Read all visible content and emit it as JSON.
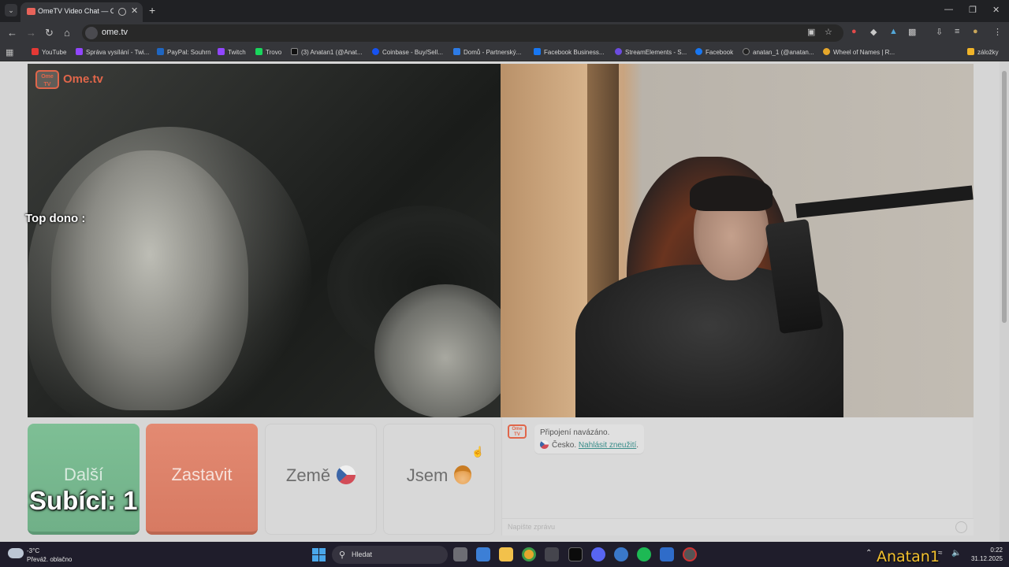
{
  "browser": {
    "tab_title": "OmeTV Video Chat — Omegle",
    "url": "ome.tv",
    "bookmarks": [
      {
        "label": "YouTube",
        "color": "#e53935"
      },
      {
        "label": "Správa vysílání - Twi...",
        "color": "#9146ff"
      },
      {
        "label": "PayPal: Souhrn",
        "color": "#1f66c1"
      },
      {
        "label": "Twitch",
        "color": "#9146ff"
      },
      {
        "label": "Trovo",
        "color": "#19d65c"
      },
      {
        "label": "(3) Anatan1 (@Anat...",
        "color": "#111111"
      },
      {
        "label": "Coinbase - Buy/Sell...",
        "color": "#1652f0"
      },
      {
        "label": "Domů - Partnerský...",
        "color": "#2d7be5"
      },
      {
        "label": "Facebook Business...",
        "color": "#1877f2"
      },
      {
        "label": "StreamElements - S...",
        "color": "#6c4ce0"
      },
      {
        "label": "Facebook",
        "color": "#1877f2"
      },
      {
        "label": "anatan_1 (@anatan...",
        "color": "#222222"
      },
      {
        "label": "Wheel of Names | R...",
        "color": "#e6a72b"
      },
      {
        "label": "záložky",
        "color": "#f0b429"
      }
    ]
  },
  "site": {
    "logo_box": "Ome TV",
    "logo_text": "Ome.tv"
  },
  "overlay": {
    "top_dono": "Top dono :",
    "subs": "Subíci: 1",
    "watermark": "Anatan1"
  },
  "buttons": {
    "next": "Další",
    "stop": "Zastavit",
    "country": "Země",
    "iam": "Jsem"
  },
  "chat": {
    "logo_box": "Ome TV",
    "connected": "Připojení navázáno.",
    "country": "Česko.",
    "report": "Nahlásit zneužití",
    "report_suffix": ".",
    "placeholder": "Napište zprávu"
  },
  "taskbar": {
    "temp": "-3°C",
    "weather": "Převáž. oblačno",
    "search": "Hledat",
    "time": "0:22",
    "date": "31.12.2025"
  }
}
